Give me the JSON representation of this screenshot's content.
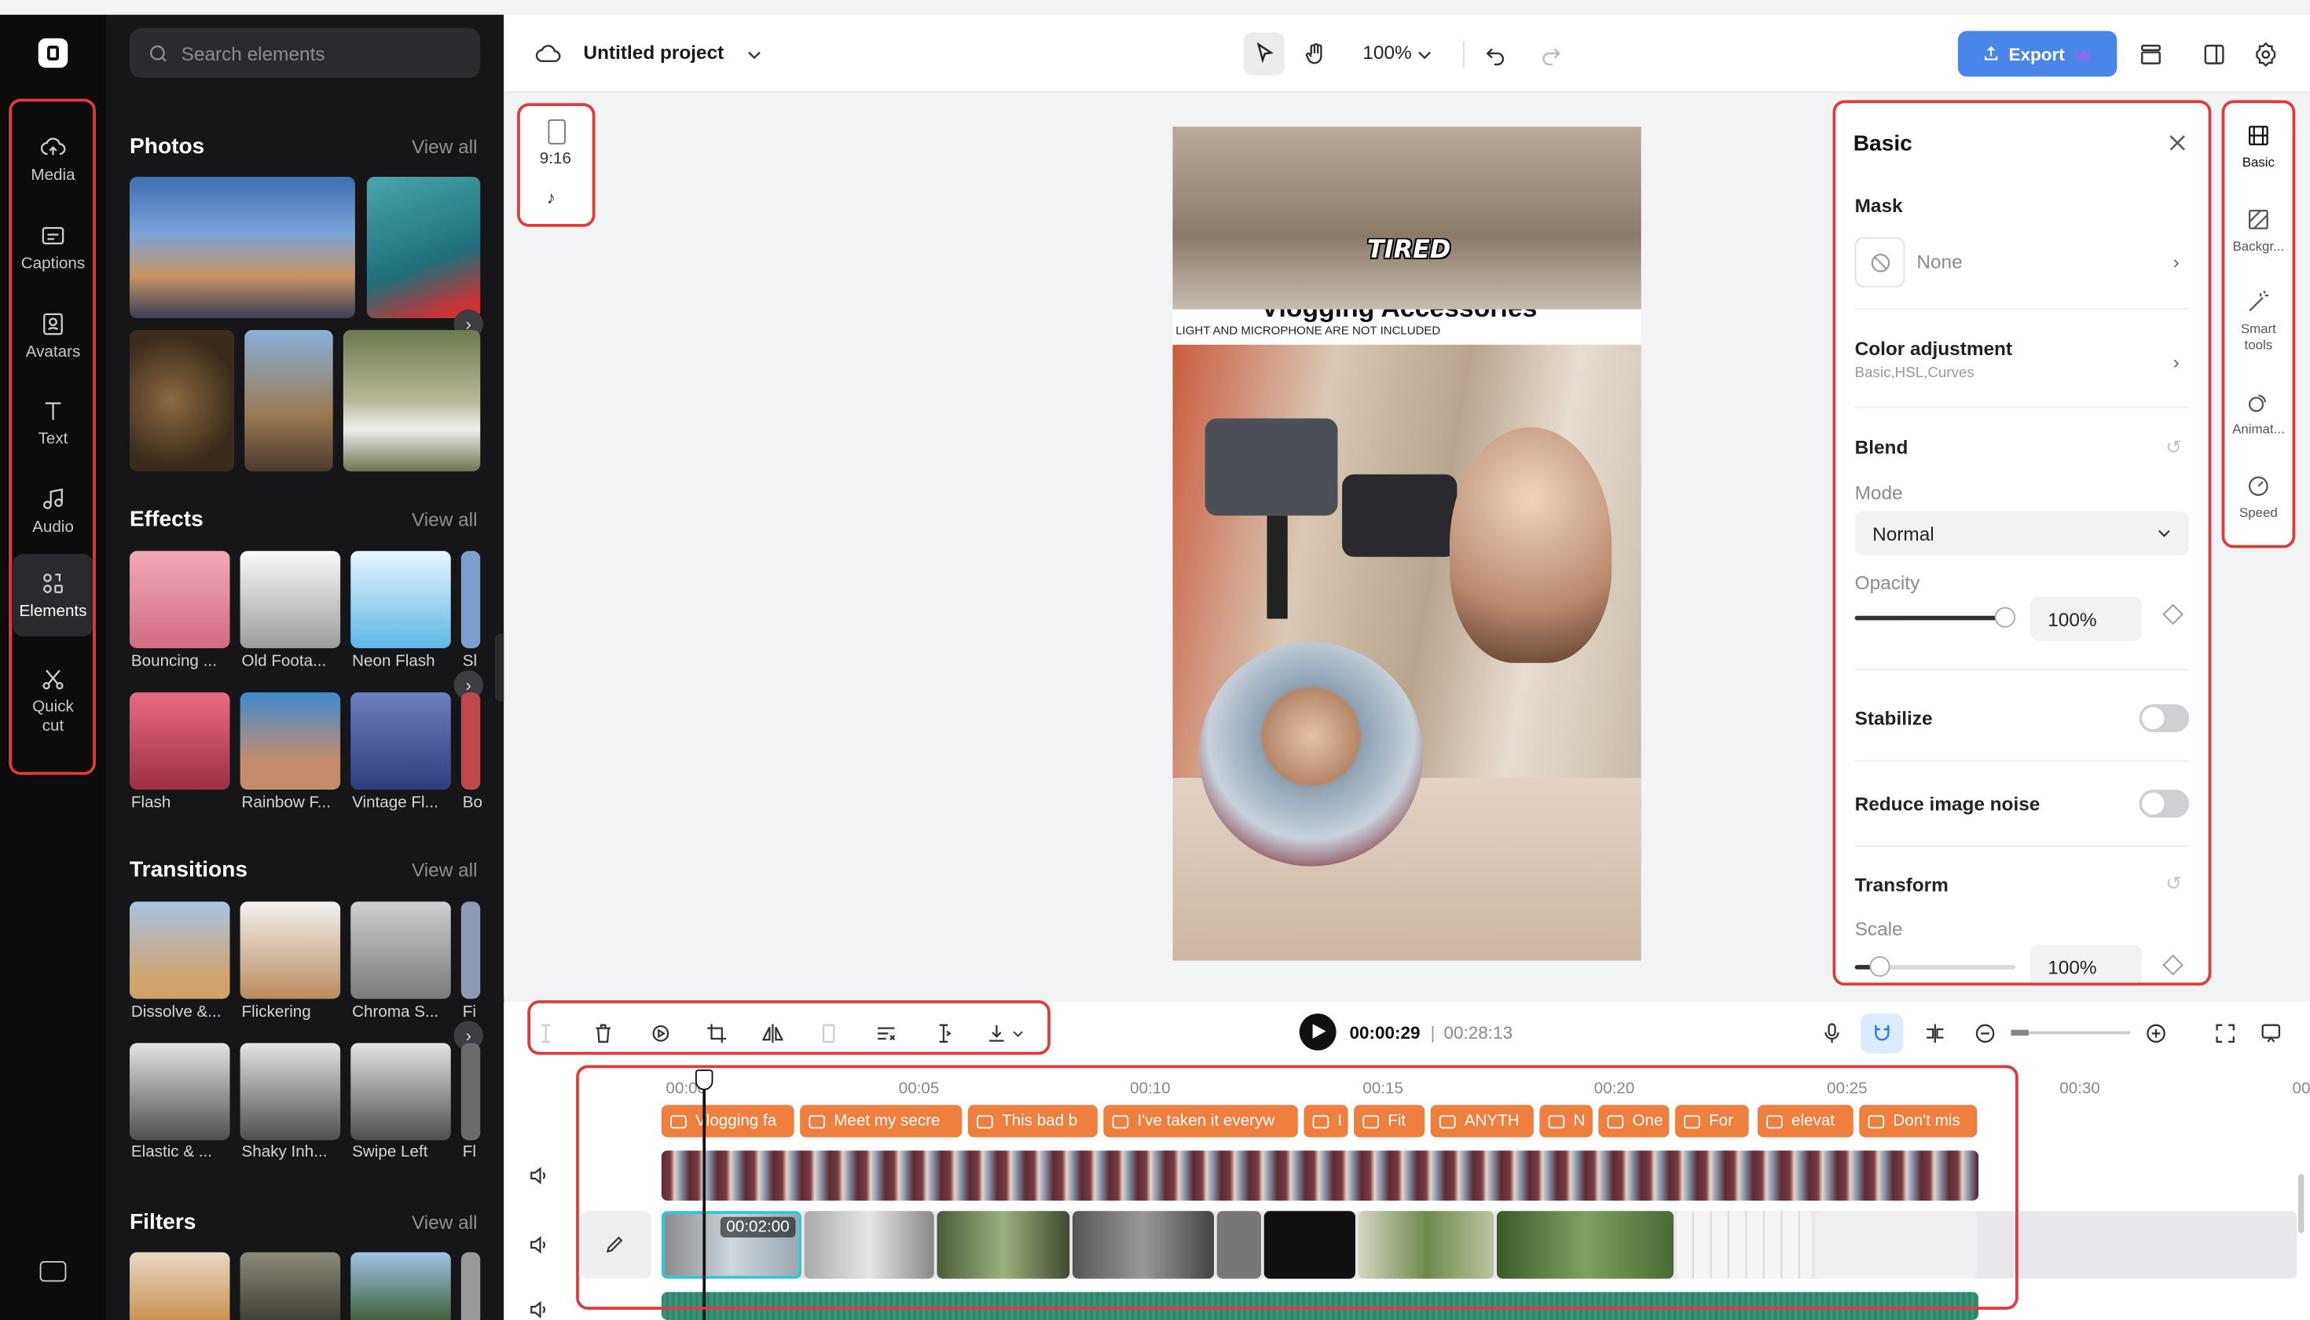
{
  "rail": {
    "items": [
      {
        "label": "Media",
        "icon": "cloud-upload-icon"
      },
      {
        "label": "Captions",
        "icon": "captions-icon"
      },
      {
        "label": "Avatars",
        "icon": "avatar-icon"
      },
      {
        "label": "Text",
        "icon": "text-icon"
      },
      {
        "label": "Audio",
        "icon": "music-note-icon"
      },
      {
        "label": "Elements",
        "icon": "elements-icon"
      },
      {
        "label": "Quick cut",
        "icon": "scissors-icon"
      }
    ],
    "active": "Elements"
  },
  "panel": {
    "search_placeholder": "Search elements",
    "photos": {
      "title": "Photos",
      "view_all": "View all"
    },
    "effects": {
      "title": "Effects",
      "view_all": "View all",
      "items": [
        "Bouncing ...",
        "Old Foota...",
        "Neon Flash",
        "Sl",
        "Flash",
        "Rainbow F...",
        "Vintage Fl...",
        "Bo"
      ]
    },
    "transitions": {
      "title": "Transitions",
      "view_all": "View all",
      "items": [
        "Dissolve &...",
        "Flickering",
        "Chroma S...",
        "Fi",
        "Elastic & ...",
        "Shaky Inh...",
        "Swipe Left",
        "Fl"
      ]
    },
    "filters": {
      "title": "Filters",
      "view_all": "View all"
    }
  },
  "topbar": {
    "project_name": "Untitled project",
    "zoom": "100%",
    "export_label": "Export"
  },
  "aspect": {
    "ratio": "9:16"
  },
  "preview": {
    "overlay_text": "TIRED",
    "banner_title": "Vlogging Accessories",
    "banner_sub": "LIGHT AND MICROPHONE ARE NOT INCLUDED"
  },
  "basic_panel": {
    "title": "Basic",
    "mask_label": "Mask",
    "mask_value": "None",
    "color_adj_label": "Color adjustment",
    "color_adj_sub": "Basic,HSL,Curves",
    "blend_label": "Blend",
    "mode_label": "Mode",
    "mode_value": "Normal",
    "opacity_label": "Opacity",
    "opacity_value": "100%",
    "opacity_level": 1.0,
    "stabilize_label": "Stabilize",
    "stabilize_on": false,
    "noise_label": "Reduce image noise",
    "noise_on": false,
    "transform_label": "Transform",
    "scale_label": "Scale",
    "scale_value": "100%",
    "scale_level": 0.1
  },
  "right_tabs": [
    {
      "label": "Basic",
      "icon": "film-icon"
    },
    {
      "label": "Backgr...",
      "icon": "background-icon"
    },
    {
      "label": "Smart tools",
      "icon": "magic-wand-icon"
    },
    {
      "label": "Animat...",
      "icon": "animation-icon"
    },
    {
      "label": "Speed",
      "icon": "speed-icon"
    }
  ],
  "playback": {
    "current": "00:00:29",
    "total": "00:28:13"
  },
  "timeline": {
    "ruler": [
      "00:00",
      "00:05",
      "00:10",
      "00:15",
      "00:20",
      "00:25",
      "00:30",
      "00"
    ],
    "captions": [
      "Vlogging fa",
      "Meet my secre",
      "This bad b",
      "I've taken it everyw",
      "I",
      "Fit",
      "ANYTH",
      "N",
      "One",
      "For",
      "elevat",
      "Don't mis"
    ],
    "clip_time": "00:02:00"
  },
  "colors": {
    "accent": "#4a86e8",
    "caption_clip": "#ee7f3f",
    "highlight": "#e0393e"
  }
}
